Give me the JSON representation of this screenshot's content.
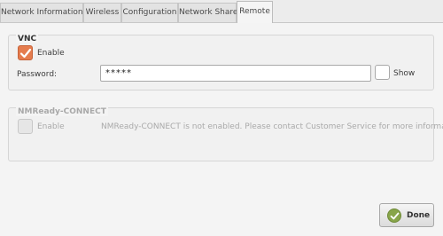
{
  "tabs": [
    {
      "label": "Network Information"
    },
    {
      "label": "Wireless"
    },
    {
      "label": "Configuration"
    },
    {
      "label": "Network Share"
    },
    {
      "label": "Remote"
    }
  ],
  "vnc": {
    "title": "VNC",
    "enable_label": "Enable",
    "enable_checked": true,
    "password_label": "Password:",
    "password_value": "*****",
    "show_label": "Show",
    "show_checked": false
  },
  "nmready": {
    "title": "NMReady-CONNECT",
    "enable_label": "Enable",
    "enable_checked": false,
    "message": "NMReady-CONNECT is not enabled. Please contact Customer Service for more information."
  },
  "footer": {
    "done_label": "Done"
  },
  "colors": {
    "accent_checkbox": "#e57c4e",
    "done_icon": "#88a54a"
  }
}
